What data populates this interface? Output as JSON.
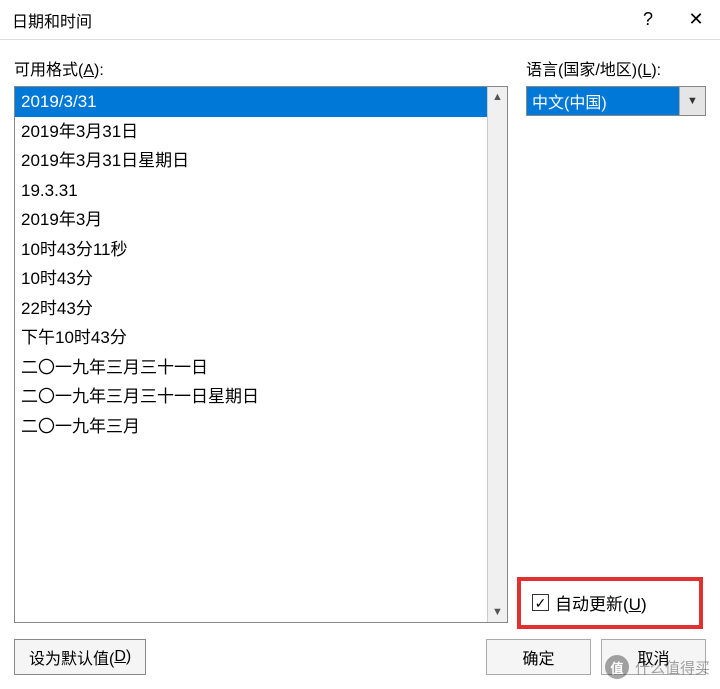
{
  "title": "日期和时间",
  "help_symbol": "?",
  "close_symbol": "✕",
  "formats": {
    "label_prefix": "可用格式(",
    "label_key": "A",
    "label_suffix": "):",
    "items": [
      "2019/3/31",
      "2019年3月31日",
      "2019年3月31日星期日",
      "19.3.31",
      "2019年3月",
      "10时43分11秒",
      "10时43分",
      "22时43分",
      "下午10时43分",
      "二〇一九年三月三十一日",
      "二〇一九年三月三十一日星期日",
      "二〇一九年三月"
    ],
    "selected_index": 0
  },
  "language": {
    "label_prefix": "语言(国家/地区)(",
    "label_key": "L",
    "label_suffix": "):",
    "value": "中文(中国)"
  },
  "auto_update": {
    "label_prefix": "自动更新(",
    "label_key": "U",
    "label_suffix": ")",
    "checked": true,
    "check_symbol": "✓"
  },
  "buttons": {
    "set_default_prefix": "设为默认值(",
    "set_default_key": "D",
    "set_default_suffix": ")",
    "ok": "确定",
    "cancel": "取消"
  },
  "watermark": {
    "icon": "值",
    "text": "什么值得买"
  },
  "scroll": {
    "up": "▲",
    "down": "▼"
  },
  "combo_arrow": "▼"
}
